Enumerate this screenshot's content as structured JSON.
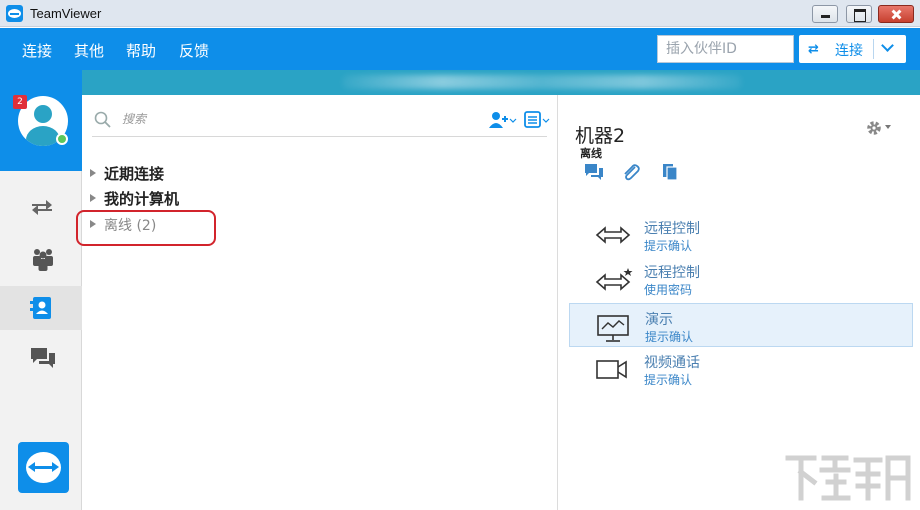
{
  "window": {
    "title": "TeamViewer"
  },
  "menu": {
    "items": [
      "连接",
      "其他",
      "帮助",
      "反馈"
    ]
  },
  "partner": {
    "placeholder": "插入伙伴ID",
    "connect_label": "连接"
  },
  "sidebar": {
    "notification_count": "2"
  },
  "search": {
    "placeholder": "搜索"
  },
  "groups": [
    {
      "label": "近期连接"
    },
    {
      "label": "我的计算机"
    },
    {
      "label": "离线 (2)"
    }
  ],
  "machine": {
    "name": "机器2",
    "status": "离线"
  },
  "actions": [
    {
      "title": "远程控制",
      "subtitle": "提示确认"
    },
    {
      "title": "远程控制",
      "subtitle": "使用密码"
    },
    {
      "title": "演示",
      "subtitle": "提示确认"
    },
    {
      "title": "视频通话",
      "subtitle": "提示确认"
    }
  ],
  "colors": {
    "brand_blue": "#0e8ee9",
    "strip_teal": "#2aa3c5",
    "annotation_red": "#d2242c",
    "online_green": "#5cc85c"
  },
  "icons": {
    "quick": [
      "chat-icon",
      "attachment-icon",
      "copy-icon"
    ],
    "sidebar": [
      "connect-arrows-icon",
      "meeting-icon",
      "contacts-icon",
      "chat-icon"
    ]
  }
}
